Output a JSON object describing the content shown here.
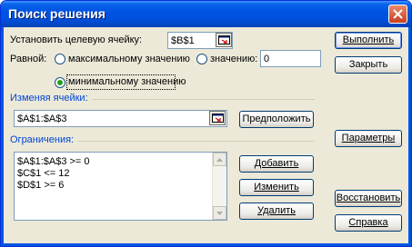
{
  "window": {
    "title": "Поиск решения"
  },
  "target": {
    "label": "Установить целевую ячейку:",
    "value": "$B$1"
  },
  "equal": {
    "label": "Равной:",
    "options": [
      "максимальному значению",
      "значению:",
      "минимальному значению"
    ],
    "selected": "минимальному значению",
    "value_input": "0"
  },
  "changing": {
    "label": "Изменяя ячейки:",
    "value": "$A$1:$A$3",
    "guess_label": "Предположить"
  },
  "constraints": {
    "label": "Ограничения:",
    "items": [
      "$A$1:$A$3 >= 0",
      "$C$1 <= 12",
      "$D$1 >= 6"
    ],
    "add_label": "Добавить",
    "change_label": "Изменить",
    "delete_label": "Удалить"
  },
  "buttons": {
    "solve": "Выполнить",
    "close": "Закрыть",
    "options": "Параметры",
    "reset": "Восстановить",
    "help": "Справка"
  },
  "icons": {
    "close": "close-icon",
    "collapse": "collapse-dialog-icon",
    "scroll_up": "arrow-up-icon",
    "scroll_down": "arrow-down-icon"
  }
}
